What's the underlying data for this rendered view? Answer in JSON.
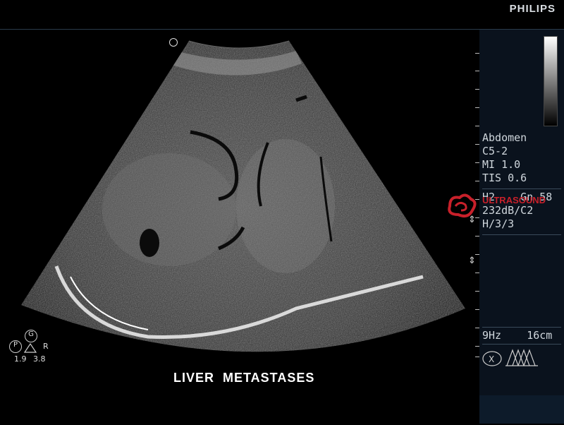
{
  "header": {
    "brand": "PHILIPS"
  },
  "image_caption": "LIVER  METASTASES",
  "params": {
    "preset": "Abdomen",
    "transducer": "C5-2",
    "mi": "MI 1.0",
    "tis": "TIS 0.6",
    "h_gain": "H2    Gn 58",
    "dynamic": "232dB/C2",
    "persist": "H/3/3",
    "rate_depth": "9Hz    16cm"
  },
  "watermark": {
    "text": "ULTRASOUND",
    "color": "#c8202a"
  },
  "probe_info": {
    "p": "P",
    "g": "G",
    "r": "R",
    "left_value": "1.9",
    "right_value": "3.8"
  },
  "colors": {
    "panel": "#0a121d",
    "accent": "#c8202a"
  }
}
